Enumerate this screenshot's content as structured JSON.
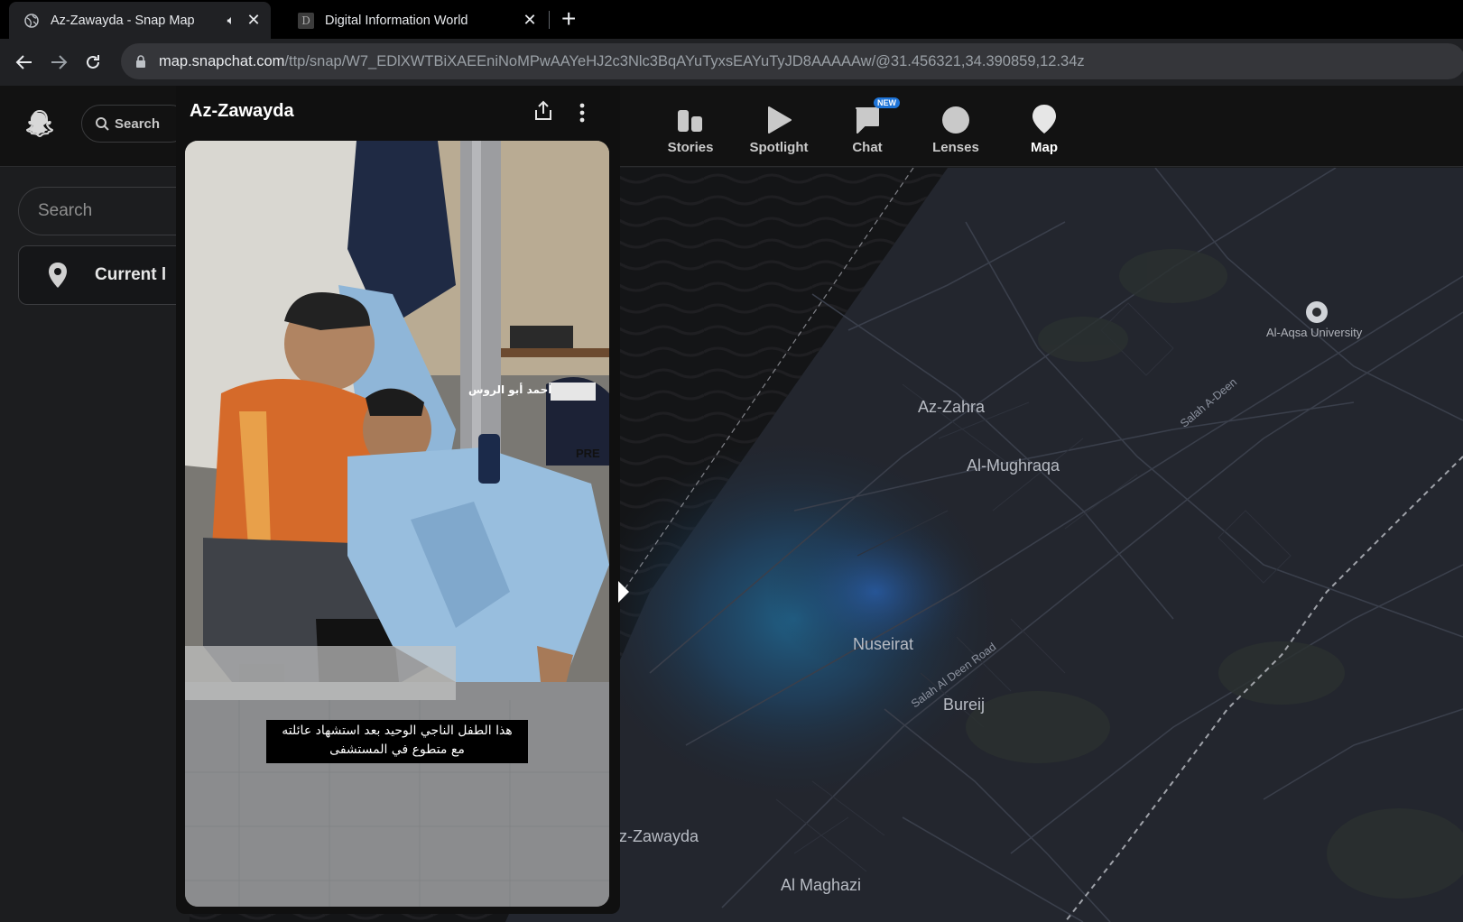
{
  "browser": {
    "tabs": [
      {
        "title": "Az-Zawayda - Snap Map",
        "favicon": "globe-icon",
        "active": true
      },
      {
        "title": "Digital Information World",
        "favicon_letter": "D",
        "active": false
      }
    ],
    "url_host": "map.snapchat.com",
    "url_path": "/ttp/snap/W7_EDlXWTBiXAEEniNoMPwAAYeHJ2c3Nlc3BqAYuTyxsEAYuTyJD8AAAAAw/@31.456321,34.390859,12.34z"
  },
  "header": {
    "search_label": "Search",
    "nav": [
      {
        "label": "Stories",
        "icon": "stories-icon"
      },
      {
        "label": "Spotlight",
        "icon": "spotlight-play-icon"
      },
      {
        "label": "Chat",
        "icon": "chat-icon",
        "badge": "NEW"
      },
      {
        "label": "Lenses",
        "icon": "lenses-icon"
      },
      {
        "label": "Map",
        "icon": "map-pin-icon",
        "active": true
      }
    ]
  },
  "sidebar": {
    "search_placeholder": "Search",
    "current_location": "Current l"
  },
  "story": {
    "title": "Az-Zawayda",
    "caption_name": "أحمد أبو الروس",
    "caption_line1": "هذا الطفل الناجي الوحيد بعد استشهاد عائلته",
    "caption_line2": "مع متطوع في المستشفى",
    "press_text": "PRE"
  },
  "map": {
    "labels": {
      "al_aqsa": "Al-Aqsa University",
      "az_zahra": "Az-Zahra",
      "al_mughraqa": "Al-Mughraqa",
      "salah_a_deen": "Salah A-Deen",
      "nuseirat": "Nuseirat",
      "salah_road": "Salah Al Deen Road",
      "bureij": "Bureij",
      "zawayda": "z-Zawayda",
      "maghazi": "Al Maghazi"
    }
  },
  "colors": {
    "map_bg": "#23262e",
    "accent_blue": "#1e74d8",
    "header_bg": "#121212"
  }
}
